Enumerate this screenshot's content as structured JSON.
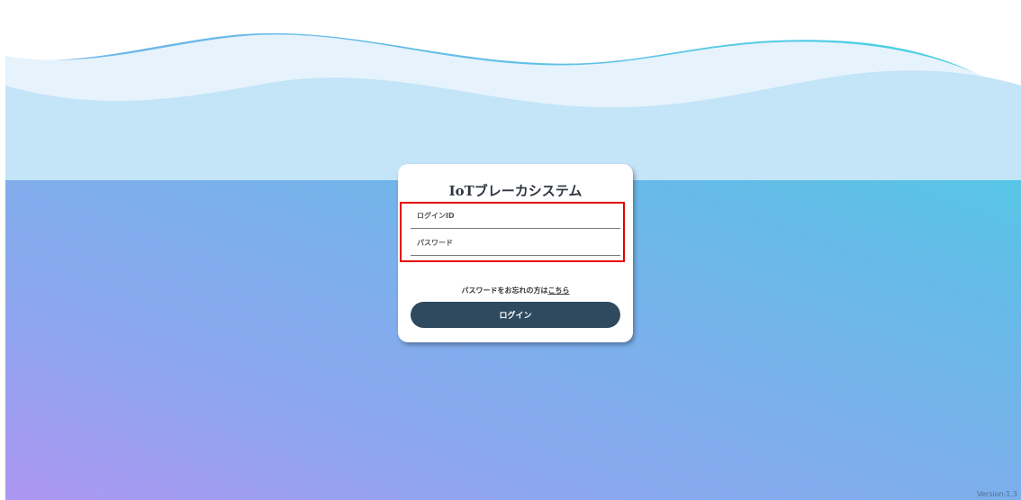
{
  "app": {
    "title": "IoTブレーカシステム"
  },
  "login_form": {
    "id_placeholder": "ログインID",
    "password_placeholder": "パスワード",
    "forgot_text": "パスワードをお忘れの方は",
    "forgot_link": "こちら",
    "login_label": "ログイン"
  },
  "footer": {
    "version": "Version:1.3"
  },
  "colors": {
    "button": "#2f4a5f",
    "highlight": "#e60000",
    "gradient_start": "#ad96f3",
    "gradient_end": "#45d6e5"
  }
}
